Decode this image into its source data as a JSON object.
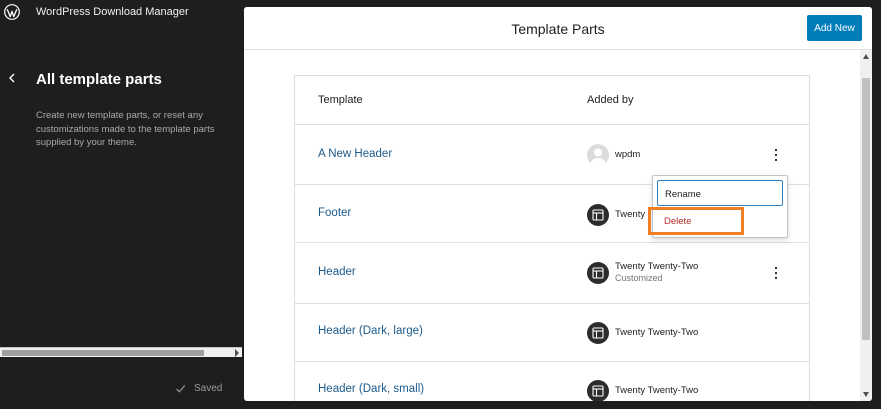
{
  "sidebar": {
    "site_title": "WordPress Download Manager",
    "title": "All template parts",
    "description": "Create new template parts, or reset any customizations made to the template parts supplied by your theme.",
    "saved_label": "Saved"
  },
  "panel": {
    "title": "Template Parts",
    "add_new_label": "Add New"
  },
  "table": {
    "columns": [
      "Template",
      "Added by"
    ],
    "rows": [
      {
        "name": "A New Header",
        "author": "wpdm",
        "author_sub": ""
      },
      {
        "name": "Footer",
        "author": "Twenty",
        "author_sub": ""
      },
      {
        "name": "Header",
        "author": "Twenty Twenty-Two",
        "author_sub": "Customized"
      },
      {
        "name": "Header (Dark, large)",
        "author": "Twenty Twenty-Two",
        "author_sub": ""
      },
      {
        "name": "Header (Dark, small)",
        "author": "Twenty Twenty-Two",
        "author_sub": ""
      }
    ]
  },
  "menu": {
    "rename_label": "Rename",
    "delete_label": "Delete"
  },
  "colors": {
    "accent": "#007cba",
    "link": "#1d5a8a",
    "danger": "#b32d2e",
    "highlight": "#f07f24"
  }
}
